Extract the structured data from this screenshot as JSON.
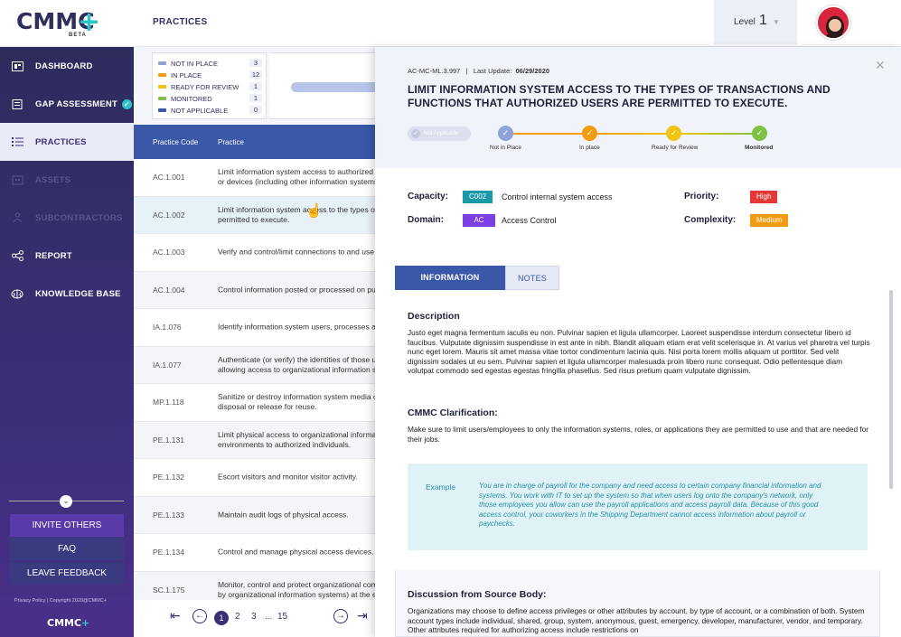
{
  "brand": {
    "logo": "CMMC",
    "beta": "BETA",
    "mark": "CMMC"
  },
  "header": {
    "title": "PRACTICES",
    "level_label": "Level",
    "level_value": "1"
  },
  "sidebar": {
    "items": [
      {
        "label": "DASHBOARD",
        "icon": "dashboard-icon"
      },
      {
        "label": "GAP ASSESSMENT",
        "icon": "clipboard-icon"
      },
      {
        "label": "PRACTICES",
        "icon": "list-icon"
      },
      {
        "label": "ASSETS",
        "icon": "building-icon"
      },
      {
        "label": "SUBCONTRACTORS",
        "icon": "people-icon"
      },
      {
        "label": "REPORT",
        "icon": "share-icon"
      },
      {
        "label": "KNOWLEDGE BASE",
        "icon": "brain-icon"
      }
    ],
    "invite": "INVITE OTHERS",
    "faq": "FAQ",
    "feedback": "LEAVE FEEDBACK",
    "footer": "Privacy Policy  |  Copyright 2020@CMMC+"
  },
  "legend": [
    {
      "label": "NOT IN PLACE",
      "count": "3",
      "color": "#8fa4d6"
    },
    {
      "label": "IN PLACE",
      "count": "12",
      "color": "#f39c12"
    },
    {
      "label": "READY FOR REVIEW",
      "count": "1",
      "color": "#f1c40f"
    },
    {
      "label": "MONITORED",
      "count": "1",
      "color": "#7dc242"
    },
    {
      "label": "NOT APPLICABLE",
      "count": "0",
      "color": "#3a57a8"
    }
  ],
  "table": {
    "headers": {
      "code": "Practice Code",
      "practice": "Practice"
    },
    "rows": [
      {
        "code": "AC.1.001",
        "practice": "Limit information system access to authorized users, processes acting on behalf of authorized users,\nor devices (including other information systems)."
      },
      {
        "code": "AC.1.002",
        "practice": "Limit information system access to the types of transactions and functions that authorized users are\npermitted to execute."
      },
      {
        "code": "AC.1.003",
        "practice": "Verify and control/limit connections to and use of external information systems."
      },
      {
        "code": "AC.1.004",
        "practice": "Control information posted or processed on publicly accessible information systems."
      },
      {
        "code": "IA.1.076",
        "practice": "Identify information system users, processes acting on behalf of users, or devices."
      },
      {
        "code": "IA.1.077",
        "practice": "Authenticate (or verify) the identities of those users, processes, or devices, as a prerequisite to\nallowing access to organizational information systems."
      },
      {
        "code": "MP.1.118",
        "practice": "Sanitize or destroy information system media containing Federal Contract Information before\ndisposal or release for reuse."
      },
      {
        "code": "PE.1.131",
        "practice": "Limit physical access to organizational information systems, equipment, and the respective operating\nenvironments to authorized individuals."
      },
      {
        "code": "PE.1.132",
        "practice": "Escort visitors and monitor visitor activity."
      },
      {
        "code": "PE.1.133",
        "practice": "Maintain audit logs of physical access."
      },
      {
        "code": "PE.1.134",
        "practice": "Control and manage physical access devices."
      },
      {
        "code": "SC.1.175",
        "practice": "Monitor, control and protect organizational communications (i.e., information transmitted or received\nby organizational information systems) at the external boundaries."
      }
    ]
  },
  "pager": {
    "pages": [
      "1",
      "2",
      "3",
      "...",
      "15"
    ]
  },
  "detail": {
    "id": "AC-MC-ML.3.997",
    "last_update_label": "Last Update:",
    "last_update": "06/29/2020",
    "title": "LIMIT INFORMATION SYSTEM ACCESS TO THE TYPES OF TRANSACTIONS AND FUNCTIONS THAT AUTHORIZED USERS ARE PERMITTED TO EXECUTE.",
    "not_applicable": "Not Applicable",
    "steps": [
      "Not in Place",
      "In place",
      "Ready for Review",
      "Monitored"
    ],
    "capacity_label": "Capacity:",
    "capacity_tag": "C002",
    "capacity_text": "Control internal system access",
    "domain_label": "Domain:",
    "domain_tag": "AC",
    "domain_text": "Access Control",
    "priority_label": "Priority:",
    "priority": "High",
    "complexity_label": "Complexity:",
    "complexity": "Medium",
    "tabs": [
      "INFORMATION",
      "NOTES"
    ],
    "desc_title": "Description",
    "desc": "Justo eget magna fermentum iaculis eu non. Pulvinar sapien et ligula ullamcorper. Laoreet suspendisse interdum consectetur libero id faucibus. Vulputate dignissim suspendisse in est ante in nibh. Blandit aliquam etiam erat velit scelerisque in. At varius vel pharetra vel turpis nunc eget lorem. Mauris sit amet massa vitae tortor condimentum lacinia quis. Nisi porta lorem mollis aliquam ut porttitor. Sed velit dignissim sodales ut eu sem. Pulvinar sapien et ligula ullamcorper malesuada proin libero nunc consequat. Odio pellentesque diam volutpat commodo sed egestas egestas fringilla phasellus. Sed risus pretium quam vulputate dignissim.",
    "clar_title": "CMMC Clarification:",
    "clar": "Make sure to limit users/employees to only the information systems, roles, or applications they are permitted to use and that are needed for their jobs.",
    "example_label": "Example",
    "example": "You are in charge of payroll for the company and need access to certain company financial information and systems. You work with IT to set up the system so that when users log onto the company's network, only those employees you allow can use the payroll applications and access payroll data. Because of this good access control, your coworkers in the Shipping Department cannot access information about payroll or paychecks.",
    "disc_title": "Discussion from Source Body:",
    "disc": "Organizations may choose to define access privileges or other attributes by account, by type of account, or a combination of both. System account types include individual, shared, group, system, anonymous, guest, emergency, developer, manufacturer, vendor, and temporary. Other attributes required for authorizing access include restrictions on"
  },
  "colors": {
    "navy": "#2d2c5c",
    "accent": "#2bc4c9",
    "blue": "#3a57a8",
    "orange": "#f39c12",
    "green": "#7dc242",
    "red": "#e53935",
    "purple": "#7b3fe4",
    "teal": "#1a9aa8"
  }
}
